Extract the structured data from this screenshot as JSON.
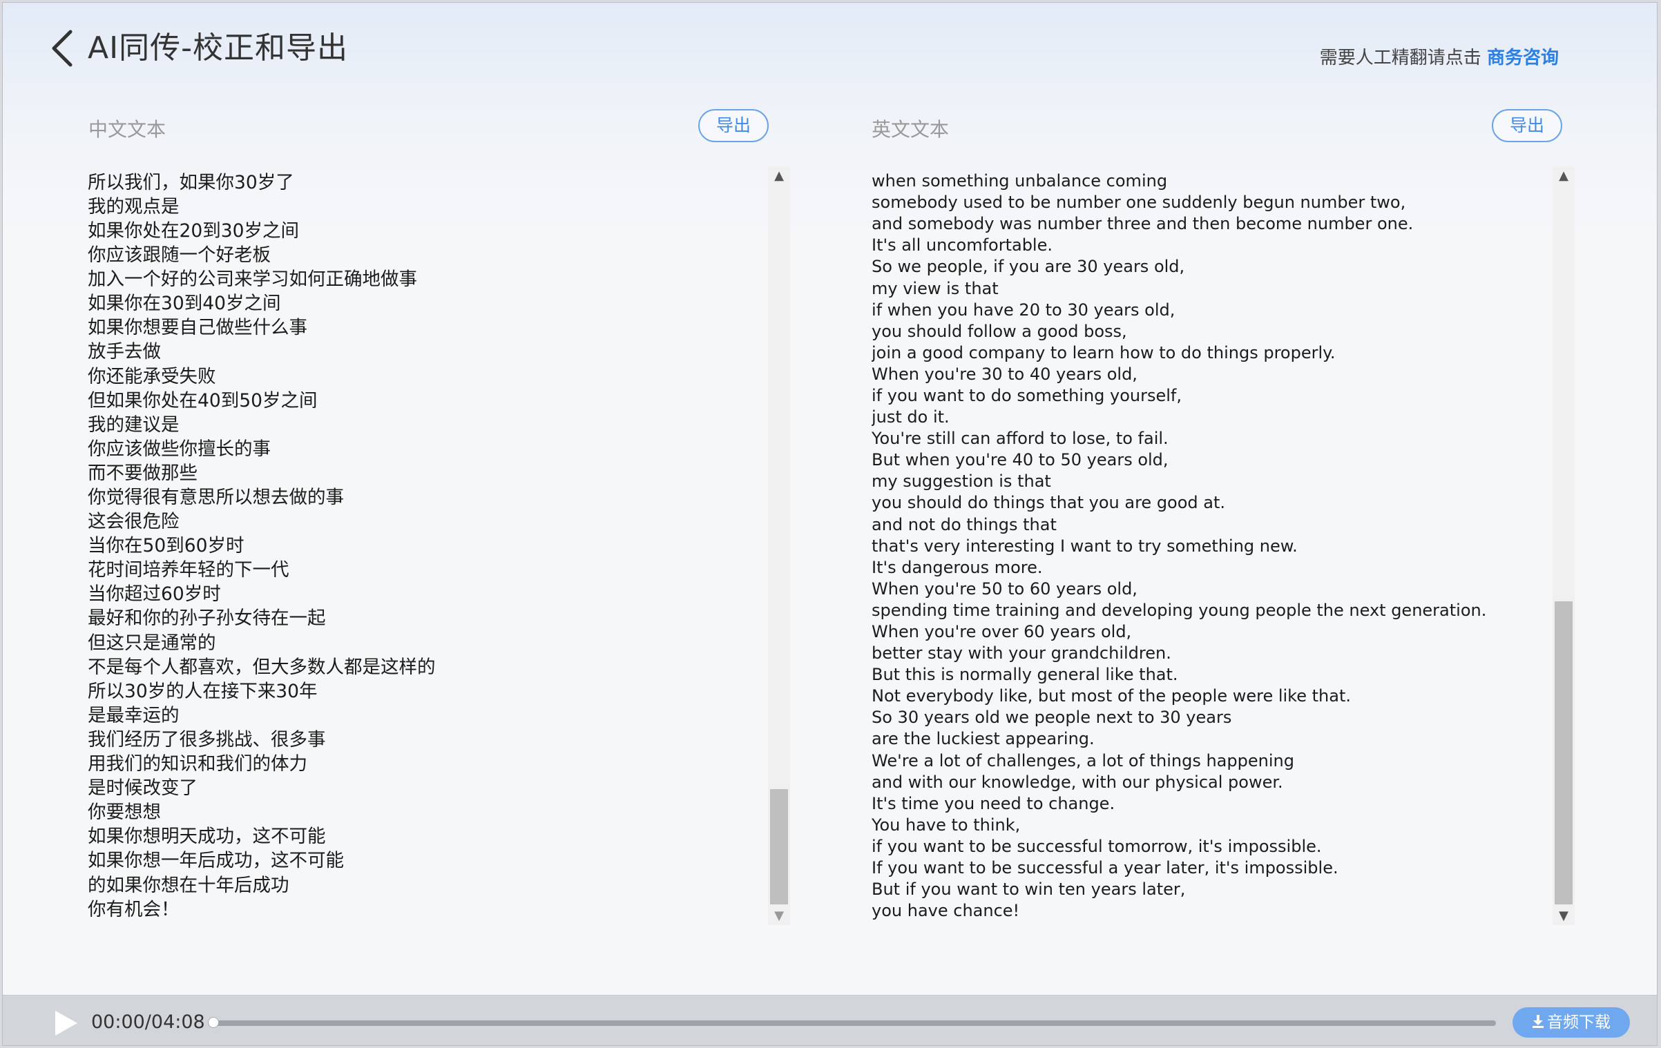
{
  "header": {
    "title": "AI同传-校正和导出",
    "consult_prefix": "需要人工精翻请点击 ",
    "consult_link": "商务咨询"
  },
  "chinese_panel": {
    "label": "中文文本",
    "export_label": "导出",
    "scroll_position": 0.84,
    "lines": [
      "所以我们，如果你30岁了",
      "我的观点是",
      "如果你处在20到30岁之间",
      "你应该跟随一个好老板",
      "加入一个好的公司来学习如何正确地做事",
      "如果你在30到40岁之间",
      "如果你想要自己做些什么事",
      "放手去做",
      "你还能承受失败",
      "但如果你处在40到50岁之间",
      "我的建议是",
      "你应该做些你擅长的事",
      "而不要做那些",
      "你觉得很有意思所以想去做的事",
      "这会很危险",
      "当你在50到60岁时",
      "花时间培养年轻的下一代",
      "当你超过60岁时",
      "最好和你的孙子孙女待在一起",
      "但这只是通常的",
      "不是每个人都喜欢，但大多数人都是这样的",
      "所以30岁的人在接下来30年",
      "是最幸运的",
      "我们经历了很多挑战、很多事",
      "用我们的知识和我们的体力",
      "是时候改变了",
      "你要想想",
      "如果你想明天成功，这不可能",
      "如果你想一年后成功，这不可能",
      "的如果你想在十年后成功",
      "你有机会！"
    ]
  },
  "english_panel": {
    "label": "英文文本",
    "export_label": "导出",
    "scroll_position": 0.58,
    "lines": [
      "when something unbalance coming",
      "somebody used to be number one suddenly begun number two,",
      "and somebody was number three and then become number one.",
      "It's all uncomfortable.",
      "So we people, if you are 30 years old,",
      "my view is that",
      "if when you have 20 to 30 years old,",
      "you should follow a good boss,",
      "join a good company to learn how to do things properly.",
      "When you're 30 to 40 years old,",
      "if you want to do something yourself,",
      "just do it.",
      "You're still can afford to lose, to fail.",
      "But when you're 40 to 50 years old,",
      "my suggestion is that",
      "you should do things that you are good at.",
      "and not do things that",
      "that's very interesting I want to try something new.",
      "It's dangerous more.",
      "When you're 50 to 60 years old,",
      "spending time training and developing young people the next generation.",
      "When you're over 60 years old,",
      "better stay with your grandchildren.",
      "But this is normally general like that.",
      "Not everybody like, but most of the people were like that.",
      "So 30 years old we people next to 30 years",
      "are the luckiest appearing.",
      "We're a lot of challenges, a lot of things happening",
      "and with our knowledge, with our physical power.",
      "It's time you need to change.",
      "You have to think,",
      "if you want to be successful tomorrow, it's impossible.",
      "If you want to be successful a year later, it's impossible.",
      "But if you want to win ten years later,",
      "you have chance!"
    ]
  },
  "player": {
    "time": "00:00/04:08",
    "progress": 0,
    "download_label": "音频下载"
  }
}
